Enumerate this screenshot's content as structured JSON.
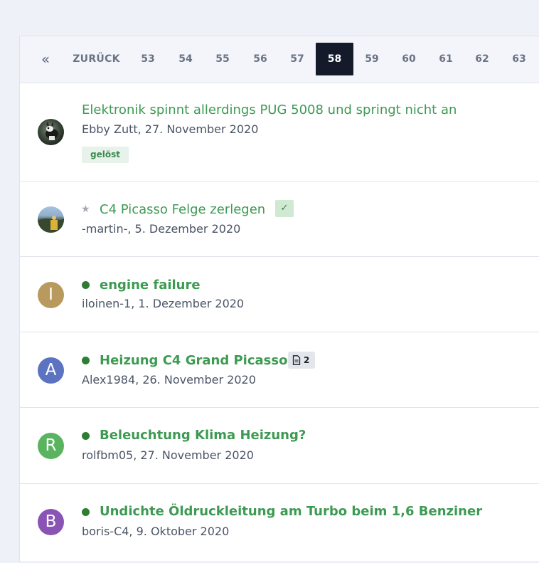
{
  "pager": {
    "first_icon": "double-chevron-left-icon",
    "first_glyph": "«",
    "back_label": "ZURÜCK",
    "pages": [
      "53",
      "54",
      "55",
      "56",
      "57",
      "58",
      "59",
      "60",
      "61",
      "62",
      "63"
    ],
    "active_page": "58"
  },
  "threads": [
    {
      "title": "Elektronik spinnt allerdings PUG 5008 und springt nicht an",
      "author": "Ebby Zutt, 27. November 2020",
      "tag": "gelöst"
    },
    {
      "star_glyph": "★",
      "title": "C4 Picasso Felge zerlegen",
      "author": "-martin-, 5. Dezember 2020",
      "check_glyph": "✓"
    },
    {
      "avatar_letter": "I",
      "avatar_color": "#b89a5e",
      "title": "engine failure",
      "author": "iloinen-1, 1. Dezember 2020"
    },
    {
      "avatar_letter": "A",
      "avatar_color": "#5b73c0",
      "title": "Heizung C4 Grand Picasso",
      "author": "Alex1984, 26. November 2020",
      "attachment_count": "2"
    },
    {
      "avatar_letter": "R",
      "avatar_color": "#5ab35f",
      "title": "Beleuchtung Klima Heizung?",
      "author": "rolfbm05, 27. November 2020"
    },
    {
      "avatar_letter": "B",
      "avatar_color": "#8a54b5",
      "title": "Undichte Öldruckleitung am Turbo beim 1,6 Benziner",
      "author": "boris-C4, 9. Oktober 2020"
    }
  ],
  "colors": {
    "link_green": "#3d9a52",
    "unread_dot": "#2e7d32",
    "active_page_bg": "#141a2a"
  }
}
